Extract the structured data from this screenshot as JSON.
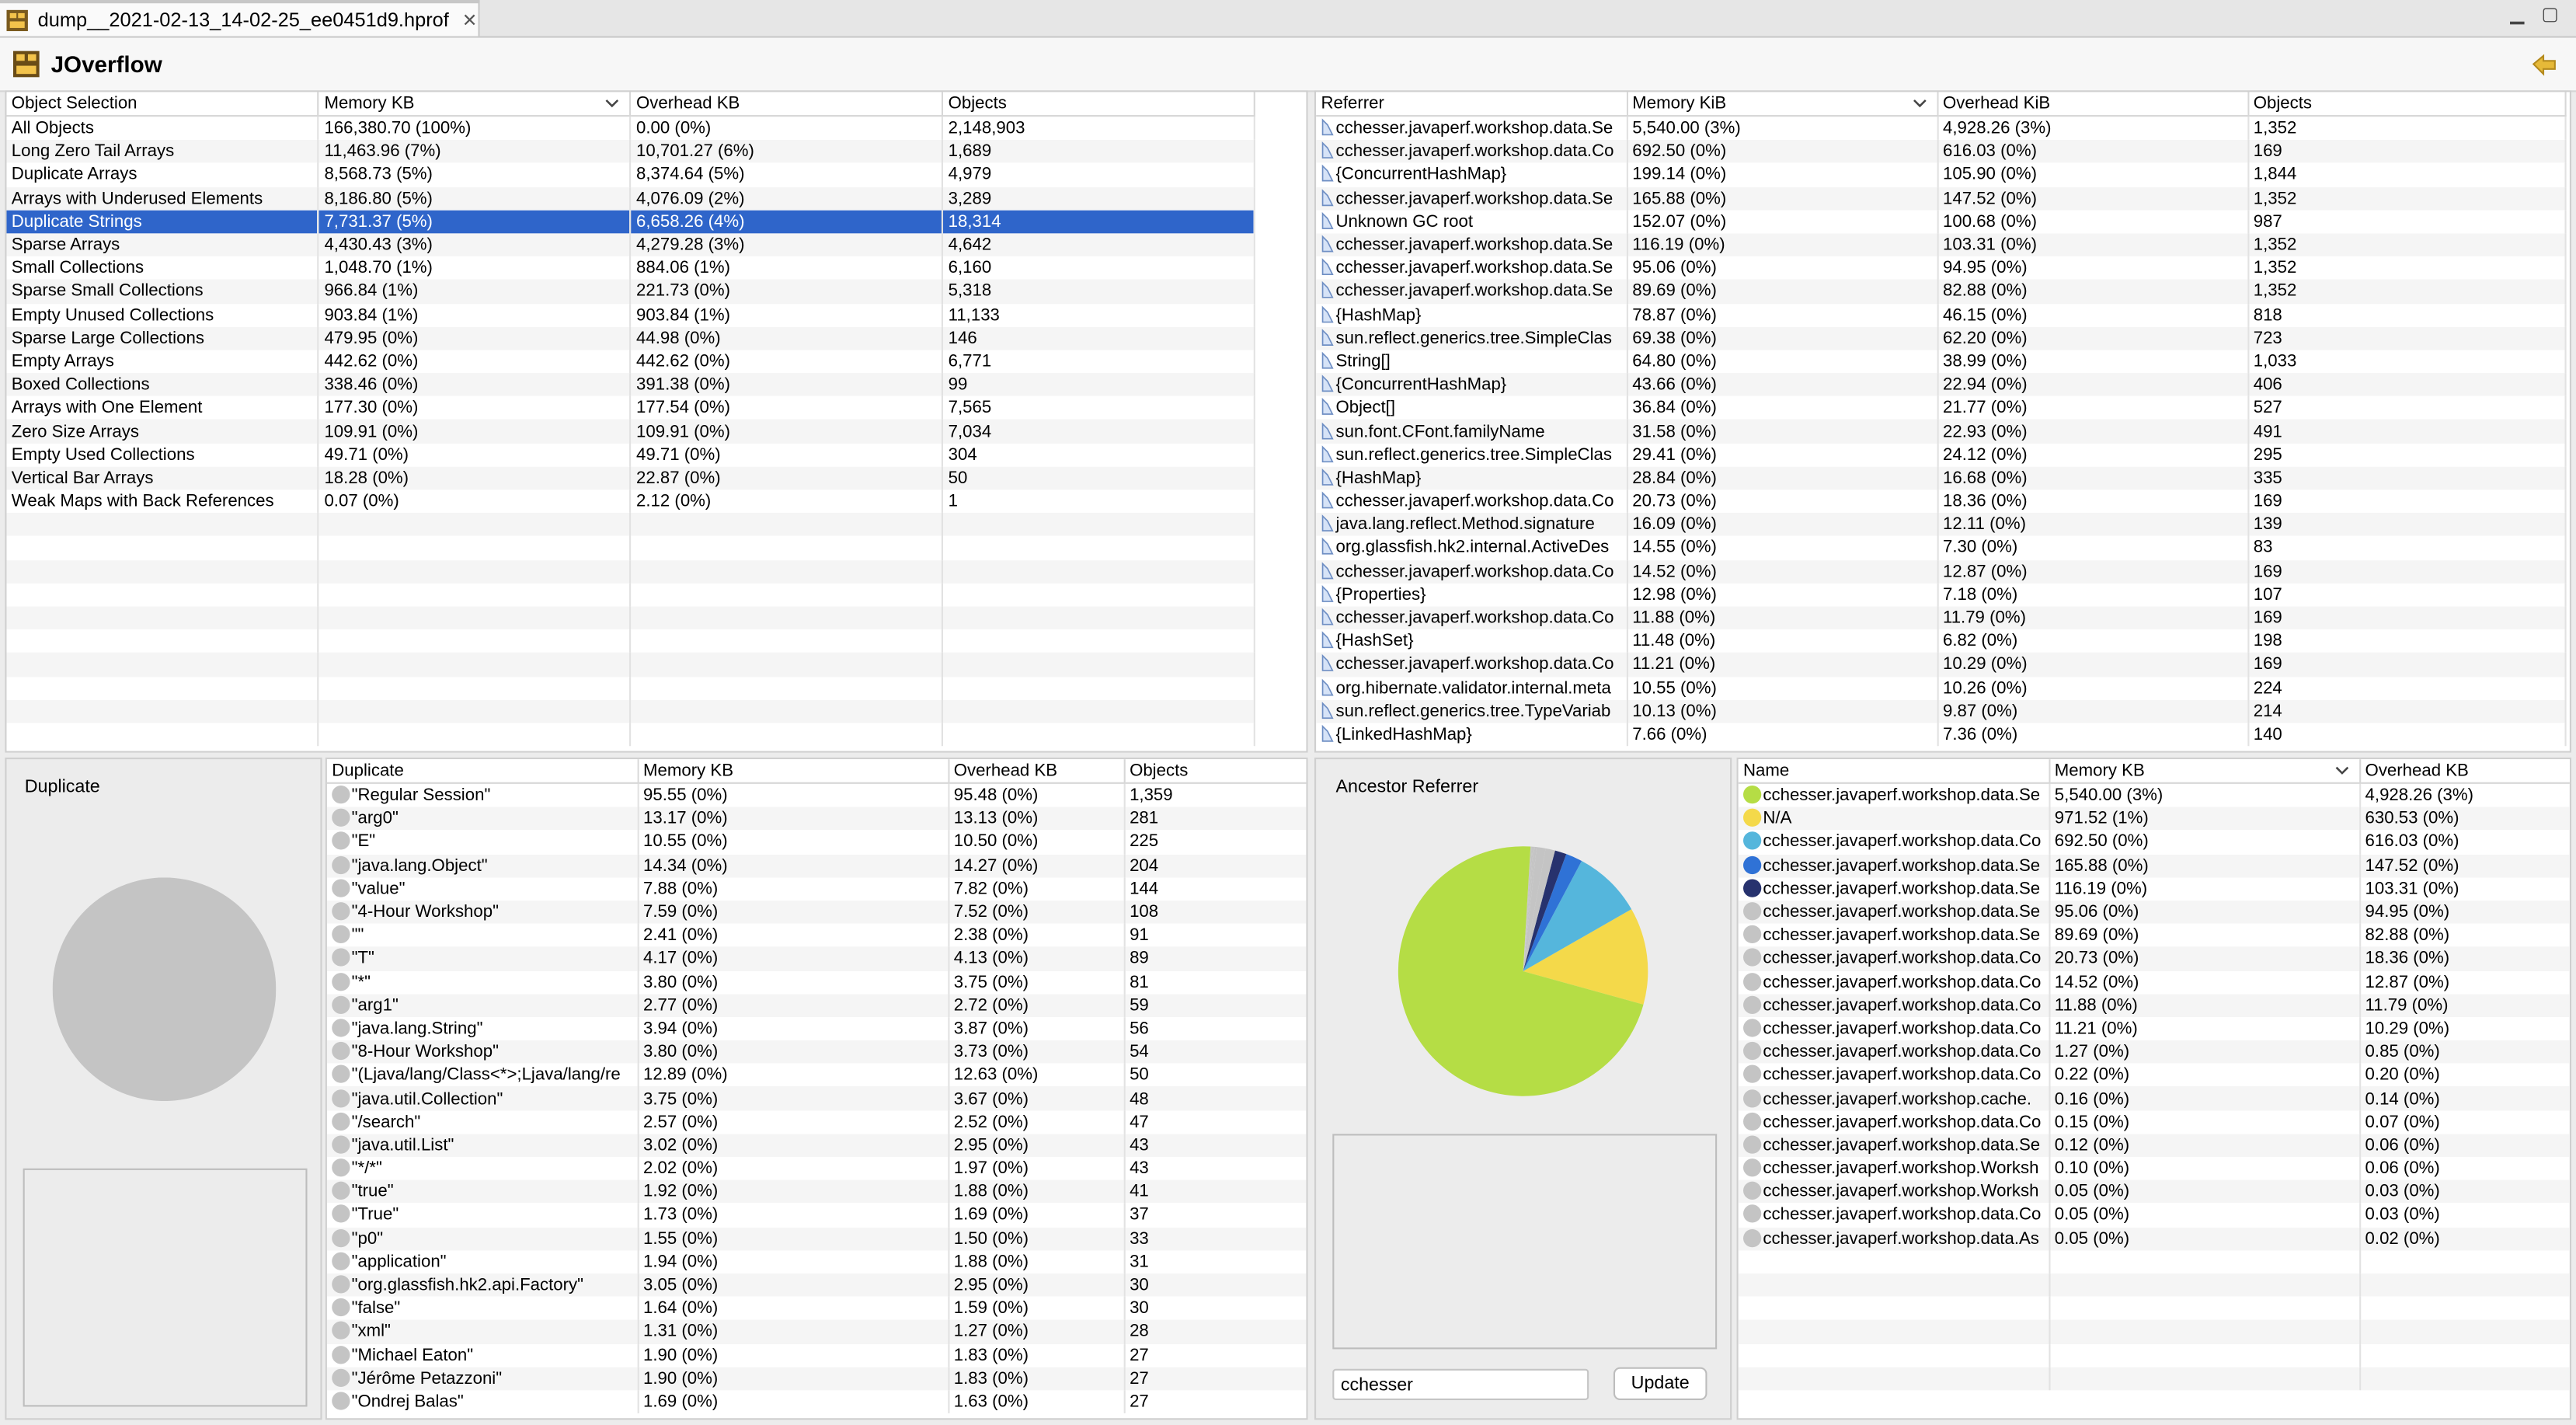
{
  "window": {
    "tab_title": "dump__2021-02-13_14-02-25_ee0451d9.hprof",
    "app_title": "JOverflow"
  },
  "object_selection": {
    "columns": [
      "Object Selection",
      "Memory KB",
      "Overhead KB",
      "Objects"
    ],
    "rows": [
      [
        "All Objects",
        "166,380.70 (100%)",
        "0.00 (0%)",
        "2,148,903"
      ],
      [
        "Long Zero Tail Arrays",
        "11,463.96 (7%)",
        "10,701.27 (6%)",
        "1,689"
      ],
      [
        "Duplicate Arrays",
        "8,568.73 (5%)",
        "8,374.64 (5%)",
        "4,979"
      ],
      [
        "Arrays with Underused Elements",
        "8,186.80 (5%)",
        "4,076.09 (2%)",
        "3,289"
      ],
      [
        "Duplicate Strings",
        "7,731.37 (5%)",
        "6,658.26 (4%)",
        "18,314"
      ],
      [
        "Sparse Arrays",
        "4,430.43 (3%)",
        "4,279.28 (3%)",
        "4,642"
      ],
      [
        "Small Collections",
        "1,048.70 (1%)",
        "884.06 (1%)",
        "6,160"
      ],
      [
        "Sparse Small Collections",
        "966.84 (1%)",
        "221.73 (0%)",
        "5,318"
      ],
      [
        "Empty Unused Collections",
        "903.84 (1%)",
        "903.84 (1%)",
        "11,133"
      ],
      [
        "Sparse Large Collections",
        "479.95 (0%)",
        "44.98 (0%)",
        "146"
      ],
      [
        "Empty Arrays",
        "442.62 (0%)",
        "442.62 (0%)",
        "6,771"
      ],
      [
        "Boxed Collections",
        "338.46 (0%)",
        "391.38 (0%)",
        "99"
      ],
      [
        "Arrays with One Element",
        "177.30 (0%)",
        "177.54 (0%)",
        "7,565"
      ],
      [
        "Zero Size Arrays",
        "109.91 (0%)",
        "109.91 (0%)",
        "7,034"
      ],
      [
        "Empty Used Collections",
        "49.71 (0%)",
        "49.71 (0%)",
        "304"
      ],
      [
        "Vertical Bar Arrays",
        "18.28 (0%)",
        "22.87 (0%)",
        "50"
      ],
      [
        "Weak Maps with Back References",
        "0.07 (0%)",
        "2.12 (0%)",
        "1"
      ]
    ],
    "selected_index": 4
  },
  "referrer": {
    "columns": [
      "Referrer",
      "Memory KiB",
      "Overhead KiB",
      "Objects"
    ],
    "rows": [
      [
        "cchesser.javaperf.workshop.data.Se",
        "5,540.00 (3%)",
        "4,928.26 (3%)",
        "1,352"
      ],
      [
        "cchesser.javaperf.workshop.data.Co",
        "692.50 (0%)",
        "616.03 (0%)",
        "169"
      ],
      [
        "{ConcurrentHashMap}",
        "199.14 (0%)",
        "105.90 (0%)",
        "1,844"
      ],
      [
        "cchesser.javaperf.workshop.data.Se",
        "165.88 (0%)",
        "147.52 (0%)",
        "1,352"
      ],
      [
        "Unknown GC root",
        "152.07 (0%)",
        "100.68 (0%)",
        "987"
      ],
      [
        "cchesser.javaperf.workshop.data.Se",
        "116.19 (0%)",
        "103.31 (0%)",
        "1,352"
      ],
      [
        "cchesser.javaperf.workshop.data.Se",
        "95.06 (0%)",
        "94.95 (0%)",
        "1,352"
      ],
      [
        "cchesser.javaperf.workshop.data.Se",
        "89.69 (0%)",
        "82.88 (0%)",
        "1,352"
      ],
      [
        "{HashMap}",
        "78.87 (0%)",
        "46.15 (0%)",
        "818"
      ],
      [
        "sun.reflect.generics.tree.SimpleClas",
        "69.38 (0%)",
        "62.20 (0%)",
        "723"
      ],
      [
        "String[]",
        "64.80 (0%)",
        "38.99 (0%)",
        "1,033"
      ],
      [
        "{ConcurrentHashMap}",
        "43.66 (0%)",
        "22.94 (0%)",
        "406"
      ],
      [
        "Object[]",
        "36.84 (0%)",
        "21.77 (0%)",
        "527"
      ],
      [
        "sun.font.CFont.familyName",
        "31.58 (0%)",
        "22.93 (0%)",
        "491"
      ],
      [
        "sun.reflect.generics.tree.SimpleClas",
        "29.41 (0%)",
        "24.12 (0%)",
        "295"
      ],
      [
        "{HashMap}",
        "28.84 (0%)",
        "16.68 (0%)",
        "335"
      ],
      [
        "cchesser.javaperf.workshop.data.Co",
        "20.73 (0%)",
        "18.36 (0%)",
        "169"
      ],
      [
        "java.lang.reflect.Method.signature",
        "16.09 (0%)",
        "12.11 (0%)",
        "139"
      ],
      [
        "org.glassfish.hk2.internal.ActiveDes",
        "14.55 (0%)",
        "7.30 (0%)",
        "83"
      ],
      [
        "cchesser.javaperf.workshop.data.Co",
        "14.52 (0%)",
        "12.87 (0%)",
        "169"
      ],
      [
        "{Properties}",
        "12.98 (0%)",
        "7.18 (0%)",
        "107"
      ],
      [
        "cchesser.javaperf.workshop.data.Co",
        "11.88 (0%)",
        "11.79 (0%)",
        "169"
      ],
      [
        "{HashSet}",
        "11.48 (0%)",
        "6.82 (0%)",
        "198"
      ],
      [
        "cchesser.javaperf.workshop.data.Co",
        "11.21 (0%)",
        "10.29 (0%)",
        "169"
      ],
      [
        "org.hibernate.validator.internal.meta",
        "10.55 (0%)",
        "10.26 (0%)",
        "224"
      ],
      [
        "sun.reflect.generics.tree.TypeVariab",
        "10.13 (0%)",
        "9.87 (0%)",
        "214"
      ],
      [
        "{LinkedHashMap}",
        "7.66 (0%)",
        "7.36 (0%)",
        "140"
      ]
    ]
  },
  "duplicate_panel": {
    "title": "Duplicate"
  },
  "duplicate_table": {
    "columns": [
      "Duplicate",
      "Memory KB",
      "Overhead KB",
      "Objects"
    ],
    "rows": [
      [
        "\"Regular Session\"",
        "95.55 (0%)",
        "95.48 (0%)",
        "1,359"
      ],
      [
        "\"arg0\"",
        "13.17 (0%)",
        "13.13 (0%)",
        "281"
      ],
      [
        "\"E\"",
        "10.55 (0%)",
        "10.50 (0%)",
        "225"
      ],
      [
        "\"java.lang.Object\"",
        "14.34 (0%)",
        "14.27 (0%)",
        "204"
      ],
      [
        "\"value\"",
        "7.88 (0%)",
        "7.82 (0%)",
        "144"
      ],
      [
        "\"4-Hour Workshop\"",
        "7.59 (0%)",
        "7.52 (0%)",
        "108"
      ],
      [
        "\"\"",
        "2.41 (0%)",
        "2.38 (0%)",
        "91"
      ],
      [
        "\"T\"",
        "4.17 (0%)",
        "4.13 (0%)",
        "89"
      ],
      [
        "\"*\"",
        "3.80 (0%)",
        "3.75 (0%)",
        "81"
      ],
      [
        "\"arg1\"",
        "2.77 (0%)",
        "2.72 (0%)",
        "59"
      ],
      [
        "\"java.lang.String\"",
        "3.94 (0%)",
        "3.87 (0%)",
        "56"
      ],
      [
        "\"8-Hour Workshop\"",
        "3.80 (0%)",
        "3.73 (0%)",
        "54"
      ],
      [
        "\"(Ljava/lang/Class<*>;Ljava/lang/re",
        "12.89 (0%)",
        "12.63 (0%)",
        "50"
      ],
      [
        "\"java.util.Collection\"",
        "3.75 (0%)",
        "3.67 (0%)",
        "48"
      ],
      [
        "\"/search\"",
        "2.57 (0%)",
        "2.52 (0%)",
        "47"
      ],
      [
        "\"java.util.List\"",
        "3.02 (0%)",
        "2.95 (0%)",
        "43"
      ],
      [
        "\"*/*\"",
        "2.02 (0%)",
        "1.97 (0%)",
        "43"
      ],
      [
        "\"true\"",
        "1.92 (0%)",
        "1.88 (0%)",
        "41"
      ],
      [
        "\"True\"",
        "1.73 (0%)",
        "1.69 (0%)",
        "37"
      ],
      [
        "\"p0\"",
        "1.55 (0%)",
        "1.50 (0%)",
        "33"
      ],
      [
        "\"application\"",
        "1.94 (0%)",
        "1.88 (0%)",
        "31"
      ],
      [
        "\"org.glassfish.hk2.api.Factory\"",
        "3.05 (0%)",
        "2.95 (0%)",
        "30"
      ],
      [
        "\"false\"",
        "1.64 (0%)",
        "1.59 (0%)",
        "30"
      ],
      [
        "\"xml\"",
        "1.31 (0%)",
        "1.27 (0%)",
        "28"
      ],
      [
        "\"Michael Eaton\"",
        "1.90 (0%)",
        "1.83 (0%)",
        "27"
      ],
      [
        "\"Jérôme Petazzoni\"",
        "1.90 (0%)",
        "1.83 (0%)",
        "27"
      ],
      [
        "\"Ondrej Balas\"",
        "1.69 (0%)",
        "1.63 (0%)",
        "27"
      ]
    ]
  },
  "ancestor_panel": {
    "title": "Ancestor Referrer",
    "filter_value": "cchesser",
    "update_label": "Update"
  },
  "ancestor_table": {
    "columns": [
      "Name",
      "Memory KB",
      "Overhead KB"
    ],
    "rows": [
      [
        "cchesser.javaperf.workshop.data.Se",
        "5,540.00 (3%)",
        "4,928.26 (3%)",
        "#b5dd45"
      ],
      [
        "N/A",
        "971.52 (1%)",
        "630.53 (0%)",
        "#f4d94a"
      ],
      [
        "cchesser.javaperf.workshop.data.Co",
        "692.50 (0%)",
        "616.03 (0%)",
        "#55b6dc"
      ],
      [
        "cchesser.javaperf.workshop.data.Se",
        "165.88 (0%)",
        "147.52 (0%)",
        "#2f72d6"
      ],
      [
        "cchesser.javaperf.workshop.data.Se",
        "116.19 (0%)",
        "103.31 (0%)",
        "#27326e"
      ],
      [
        "cchesser.javaperf.workshop.data.Se",
        "95.06 (0%)",
        "94.95 (0%)",
        "#c4c4c4"
      ],
      [
        "cchesser.javaperf.workshop.data.Se",
        "89.69 (0%)",
        "82.88 (0%)",
        "#c4c4c4"
      ],
      [
        "cchesser.javaperf.workshop.data.Co",
        "20.73 (0%)",
        "18.36 (0%)",
        "#c4c4c4"
      ],
      [
        "cchesser.javaperf.workshop.data.Co",
        "14.52 (0%)",
        "12.87 (0%)",
        "#c4c4c4"
      ],
      [
        "cchesser.javaperf.workshop.data.Co",
        "11.88 (0%)",
        "11.79 (0%)",
        "#c4c4c4"
      ],
      [
        "cchesser.javaperf.workshop.data.Co",
        "11.21 (0%)",
        "10.29 (0%)",
        "#c4c4c4"
      ],
      [
        "cchesser.javaperf.workshop.data.Co",
        "1.27 (0%)",
        "0.85 (0%)",
        "#c4c4c4"
      ],
      [
        "cchesser.javaperf.workshop.data.Co",
        "0.22 (0%)",
        "0.20 (0%)",
        "#c4c4c4"
      ],
      [
        "cchesser.javaperf.workshop.cache.",
        "0.16 (0%)",
        "0.14 (0%)",
        "#c4c4c4"
      ],
      [
        "cchesser.javaperf.workshop.data.Co",
        "0.15 (0%)",
        "0.07 (0%)",
        "#c4c4c4"
      ],
      [
        "cchesser.javaperf.workshop.data.Se",
        "0.12 (0%)",
        "0.06 (0%)",
        "#c4c4c4"
      ],
      [
        "cchesser.javaperf.workshop.Worksh",
        "0.10 (0%)",
        "0.06 (0%)",
        "#c4c4c4"
      ],
      [
        "cchesser.javaperf.workshop.Worksh",
        "0.05 (0%)",
        "0.03 (0%)",
        "#c4c4c4"
      ],
      [
        "cchesser.javaperf.workshop.data.Co",
        "0.05 (0%)",
        "0.03 (0%)",
        "#c4c4c4"
      ],
      [
        "cchesser.javaperf.workshop.data.As",
        "0.05 (0%)",
        "0.02 (0%)",
        "#c4c4c4"
      ]
    ]
  },
  "chart_data": {
    "type": "pie",
    "values": [
      5540.0,
      971.52,
      692.5,
      165.88,
      116.19,
      95.06,
      89.69,
      20.73,
      14.52,
      11.88,
      11.21,
      1.27,
      0.22,
      0.16,
      0.15,
      0.12,
      0.1,
      0.05,
      0.05,
      0.05
    ],
    "colors": [
      "#b5dd45",
      "#f4d94a",
      "#55b6dc",
      "#2f72d6",
      "#27326e",
      "#c4c4c4",
      "#c4c4c4",
      "#c4c4c4",
      "#c4c4c4",
      "#c4c4c4",
      "#c4c4c4",
      "#c4c4c4",
      "#c4c4c4",
      "#c4c4c4",
      "#c4c4c4",
      "#c4c4c4",
      "#c4c4c4",
      "#c4c4c4",
      "#c4c4c4",
      "#c4c4c4"
    ],
    "start_angle_deg": 90,
    "direction": "clockwise"
  },
  "duplicate_chart": {
    "type": "pie",
    "values": [
      1
    ],
    "colors": [
      "#c4c4c4"
    ]
  }
}
